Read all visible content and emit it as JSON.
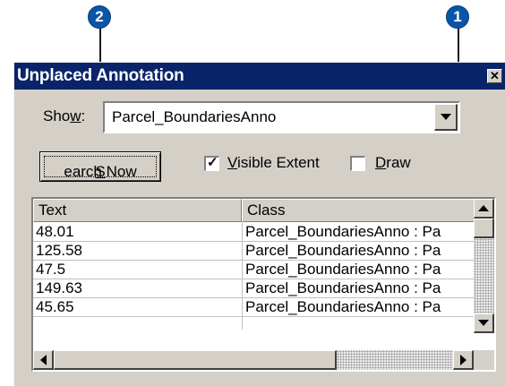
{
  "callouts": {
    "one": "1",
    "two": "2"
  },
  "window": {
    "title": "Unplaced Annotation",
    "close_glyph": "✕"
  },
  "show": {
    "label_pre": "Sho",
    "label_hotkey": "w",
    "label_post": ":",
    "value": "Parcel_BoundariesAnno"
  },
  "search_button": {
    "hotkey": "S",
    "rest": "earch Now"
  },
  "visible_extent": {
    "hotkey": "V",
    "rest": "isible Extent",
    "checked": true
  },
  "draw": {
    "hotkey": "D",
    "rest": "raw",
    "checked": false
  },
  "table": {
    "columns": [
      "Text",
      "Class"
    ],
    "rows": [
      [
        "48.01",
        "Parcel_BoundariesAnno : Pa"
      ],
      [
        "125.58",
        "Parcel_BoundariesAnno : Pa"
      ],
      [
        "47.5",
        "Parcel_BoundariesAnno : Pa"
      ],
      [
        "149.63",
        "Parcel_BoundariesAnno : Pa"
      ],
      [
        "45.65",
        "Parcel_BoundariesAnno : Pa"
      ]
    ]
  },
  "colors": {
    "titlebar": "#0a246a",
    "face": "#d4d0c8",
    "callout": "#0a55a8"
  }
}
